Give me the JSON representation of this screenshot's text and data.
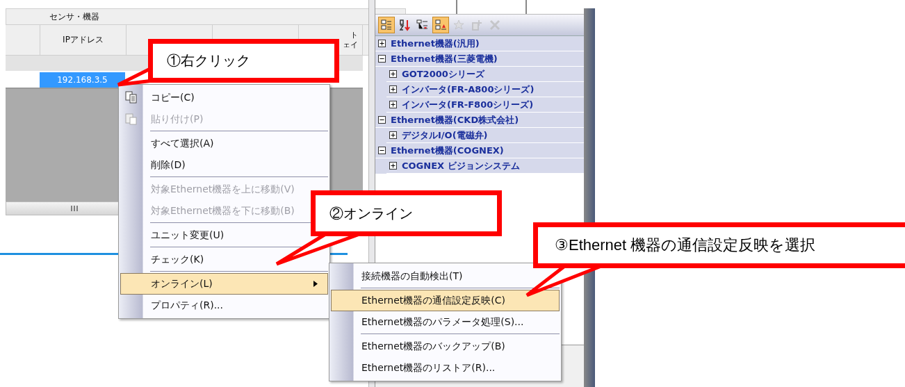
{
  "grid": {
    "group_header": "センサ・機器",
    "columns": [
      {
        "lines": [
          "IPアドレス"
        ]
      },
      {
        "lines": [
          "ト",
          "ェイ"
        ]
      }
    ],
    "rows": [
      {
        "cells": [
          "192.168.3.5"
        ],
        "selected": true
      }
    ]
  },
  "tree_toolbar": [
    {
      "selected": true,
      "disabled": false
    },
    {
      "selected": false,
      "disabled": false
    },
    {
      "selected": false,
      "disabled": false
    },
    {
      "selected": true,
      "disabled": false
    },
    {
      "selected": false,
      "disabled": true
    },
    {
      "selected": false,
      "disabled": true
    },
    {
      "selected": false,
      "disabled": true
    }
  ],
  "tree": [
    {
      "label": "Ethernet機器(汎用)",
      "expanded": false
    },
    {
      "label": "Ethernet機器(三菱電機)",
      "expanded": true,
      "children": [
        {
          "label": "GOT2000シリーズ",
          "expanded": false
        },
        {
          "label": "インバータ(FR-A800シリーズ)",
          "expanded": false
        },
        {
          "label": "インバータ(FR-F800シリーズ)",
          "expanded": false
        }
      ]
    },
    {
      "label": "Ethernet機器(CKD株式会社)",
      "expanded": true,
      "children": [
        {
          "label": "デジタルI/O(電磁弁)",
          "expanded": false
        }
      ]
    },
    {
      "label": "Ethernet機器(COGNEX)",
      "expanded": true,
      "children": [
        {
          "label": "COGNEX ビジョンシステム",
          "expanded": false
        }
      ]
    }
  ],
  "context_menu": [
    {
      "kind": "item",
      "label": "コピー(C)",
      "disabled": false,
      "selected": false,
      "submenu": false
    },
    {
      "kind": "item",
      "label": "貼り付け(P)",
      "disabled": true,
      "selected": false,
      "submenu": false
    },
    {
      "kind": "separator"
    },
    {
      "kind": "item",
      "label": "すべて選択(A)",
      "disabled": false,
      "selected": false,
      "submenu": false
    },
    {
      "kind": "item",
      "label": "削除(D)",
      "disabled": false,
      "selected": false,
      "submenu": false
    },
    {
      "kind": "separator"
    },
    {
      "kind": "item",
      "label": "対象Ethernet機器を上に移動(V)",
      "disabled": true,
      "selected": false,
      "submenu": false
    },
    {
      "kind": "item",
      "label": "対象Ethernet機器を下に移動(B)",
      "disabled": true,
      "selected": false,
      "submenu": false
    },
    {
      "kind": "separator"
    },
    {
      "kind": "item",
      "label": "ユニット変更(U)",
      "disabled": false,
      "selected": false,
      "submenu": false
    },
    {
      "kind": "separator"
    },
    {
      "kind": "item",
      "label": "チェック(K)",
      "disabled": false,
      "selected": false,
      "submenu": false
    },
    {
      "kind": "separator"
    },
    {
      "kind": "item",
      "label": "オンライン(L)",
      "disabled": false,
      "selected": true,
      "submenu": true
    },
    {
      "kind": "item",
      "label": "プロパティ(R)...",
      "disabled": false,
      "selected": false,
      "submenu": false
    }
  ],
  "submenu": [
    {
      "kind": "item",
      "label": "接続機器の自動検出(T)",
      "disabled": false,
      "selected": false,
      "submenu": false
    },
    {
      "kind": "separator"
    },
    {
      "kind": "item",
      "label": "Ethernet機器の通信設定反映(C)",
      "disabled": false,
      "selected": true,
      "submenu": false
    },
    {
      "kind": "item",
      "label": "Ethernet機器のパラメータ処理(S)...",
      "disabled": false,
      "selected": false,
      "submenu": false
    },
    {
      "kind": "separator"
    },
    {
      "kind": "item",
      "label": "Ethernet機器のバックアップ(B)",
      "disabled": false,
      "selected": false,
      "submenu": false
    },
    {
      "kind": "item",
      "label": "Ethernet機器のリストア(R)...",
      "disabled": false,
      "selected": false,
      "submenu": false
    }
  ],
  "callouts": [
    {
      "text": "①右クリック"
    },
    {
      "text": "②オンライン"
    },
    {
      "text": "③Ethernet 機器の通信設定反映を選択"
    }
  ]
}
